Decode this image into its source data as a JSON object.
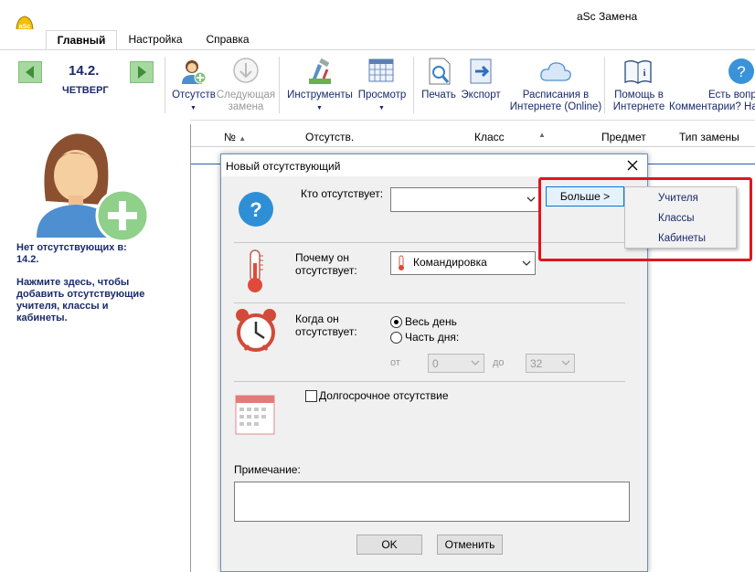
{
  "app": {
    "title": "aSc Замена"
  },
  "tabs": [
    {
      "label": "Главный",
      "active": true
    },
    {
      "label": "Настройка",
      "active": false
    },
    {
      "label": "Справка",
      "active": false
    }
  ],
  "ribbon": {
    "date_number": "14.2.",
    "date_weekday": "ЧЕТВЕРГ",
    "absence": {
      "label": "Отсутств"
    },
    "next_change": {
      "line1": "Следующая",
      "line2": "замена"
    },
    "tools": {
      "label": "Инструменты"
    },
    "view": {
      "label": "Просмотр"
    },
    "print": {
      "label": "Печать"
    },
    "export": {
      "label": "Экспорт"
    },
    "online": {
      "line1": "Расписания в",
      "line2": "Интернете (Online)"
    },
    "help": {
      "line1": "Помощь в",
      "line2": "Интернете"
    },
    "feedback": {
      "line1": "Есть вопр",
      "line2": "Комментарии? На"
    }
  },
  "left_panel": {
    "msg1_line1": "Нет отсутствующих в:",
    "msg1_line2": "14.2.",
    "msg2_line1": "Нажмите здесь, чтобы",
    "msg2_line2": "добавить отсутствующие",
    "msg2_line3": "учителя, классы и",
    "msg2_line4": "кабинеты."
  },
  "grid": {
    "columns": [
      {
        "label": "№"
      },
      {
        "label": "Отсутств."
      },
      {
        "label": "Класс"
      },
      {
        "label": "Предмет"
      },
      {
        "label": "Тип замены"
      }
    ]
  },
  "dialog": {
    "title": "Новый отсутствующий",
    "who_label": "Кто отсутствует:",
    "who_value": "",
    "more_button": "Больше >",
    "reason_label_line1": "Почему он",
    "reason_label_line2": "отсутствует:",
    "reason_value": "Командировка",
    "when_label_line1": "Когда он",
    "when_label_line2": "отсутствует:",
    "full_day": "Весь день",
    "part_day": "Часть дня:",
    "from_label": "от",
    "from_value": "0",
    "to_label": "до",
    "to_value": "32",
    "long_term": "Долгосрочное отсутствие",
    "note_label": "Примечание:",
    "ok": "OK",
    "cancel": "Отменить"
  },
  "more_menu": {
    "items": [
      {
        "label": "Учителя"
      },
      {
        "label": "Классы"
      },
      {
        "label": "Кабинеты"
      }
    ]
  },
  "colors": {
    "nav_green": "#a6d8a0",
    "text_navy": "#1a2a6a",
    "highlight_red": "#e0161e",
    "help_blue": "#2e8fd6"
  }
}
